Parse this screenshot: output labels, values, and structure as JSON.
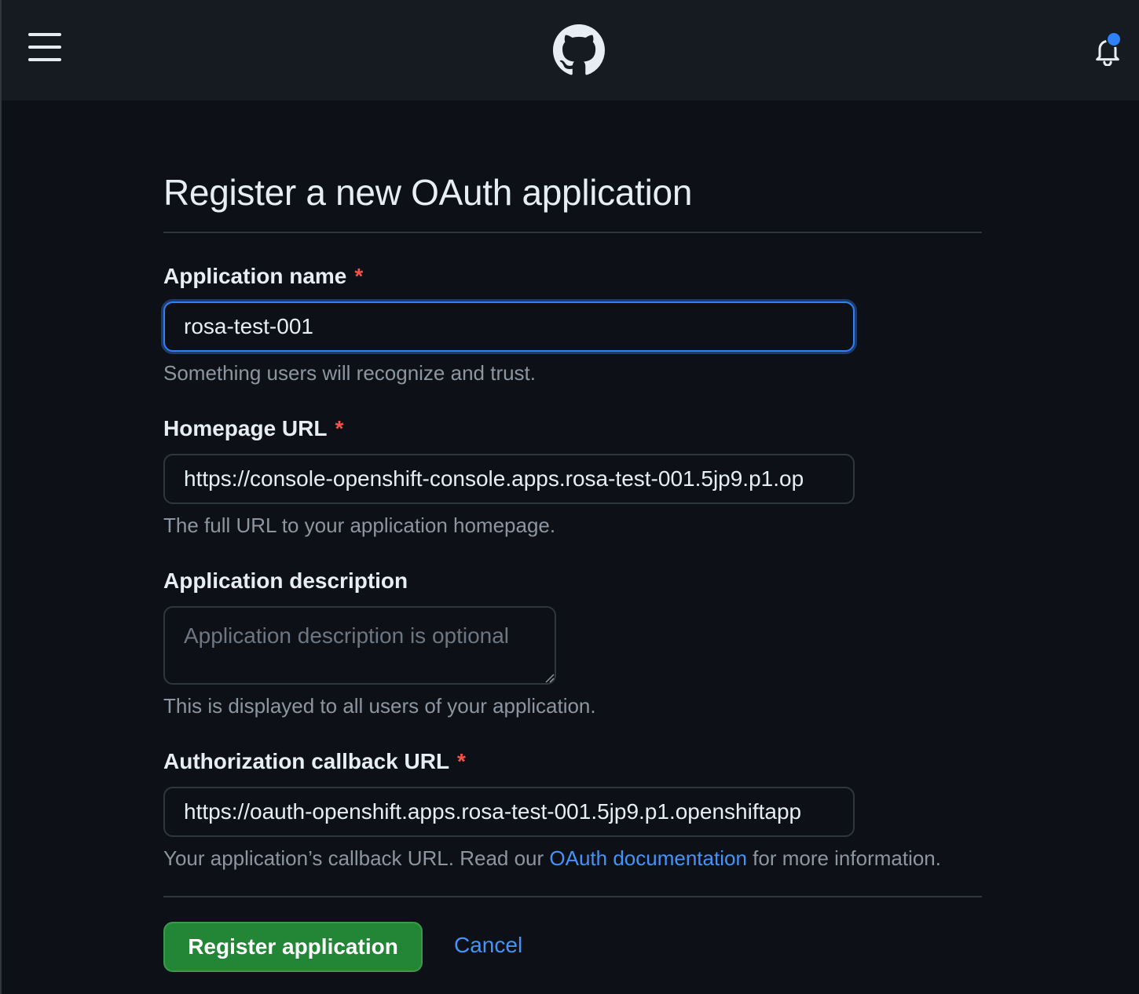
{
  "header": {
    "menu_icon": "hamburger-menu-icon",
    "logo_icon": "github-logo-icon",
    "notification_icon": "bell-icon",
    "notification_indicator_color": "#2f81f7"
  },
  "page": {
    "title": "Register a new OAuth application"
  },
  "form": {
    "app_name": {
      "label": "Application name",
      "required_marker": "*",
      "value": "rosa-test-001",
      "hint": "Something users will recognize and trust."
    },
    "homepage_url": {
      "label": "Homepage URL",
      "required_marker": "*",
      "value": "https://console-openshift-console.apps.rosa-test-001.5jp9.p1.op",
      "hint": "The full URL to your application homepage."
    },
    "description": {
      "label": "Application description",
      "placeholder": "Application description is optional",
      "hint": "This is displayed to all users of your application."
    },
    "callback_url": {
      "label": "Authorization callback URL",
      "required_marker": "*",
      "value": "https://oauth-openshift.apps.rosa-test-001.5jp9.p1.openshiftapp",
      "hint_prefix": "Your application’s callback URL. Read our ",
      "hint_link": "OAuth documentation",
      "hint_suffix": " for more information."
    }
  },
  "actions": {
    "register_label": "Register application",
    "cancel_label": "Cancel"
  },
  "colors": {
    "background": "#0d1117",
    "header": "#161b22",
    "primary_button": "#238636",
    "link": "#4493f8",
    "required": "#f85149",
    "focus": "#2f81f7"
  }
}
